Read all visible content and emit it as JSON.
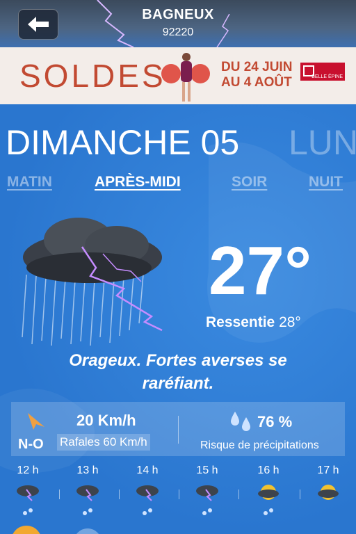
{
  "header": {
    "city": "BAGNEUX",
    "zip": "92220",
    "back_icon": "arrow-left-icon"
  },
  "ad": {
    "headline": "SOLDES",
    "dates_line1": "DU 24 JUIN",
    "dates_line2": "AU 4 AOÛT",
    "brand": "BELLE ÉPINE"
  },
  "days": {
    "current": "DIMANCHE 05",
    "next": "LUN"
  },
  "tabs": [
    {
      "label": "MATIN",
      "active": false
    },
    {
      "label": "APRÈS-MIDI",
      "active": true
    },
    {
      "label": "SOIR",
      "active": false
    },
    {
      "label": "NUIT",
      "active": false
    }
  ],
  "weather": {
    "temperature": "27°",
    "feels_label": "Ressentie",
    "feels_value": "28°",
    "description_line1": "Orageux. Fortes averses se",
    "description_line2": "raréfiant.",
    "main_icon": "thunderstorm-cloud-icon"
  },
  "details": {
    "wind_direction": "N-O",
    "wind_speed": "20 Km/h",
    "gusts": "Rafales 60 Km/h",
    "rain_probability": "76 %",
    "rain_label": "Risque de précipitations"
  },
  "hourly": [
    {
      "hour": "12 h",
      "icon": "thunderstorm-icon"
    },
    {
      "hour": "13 h",
      "icon": "thunderstorm-icon"
    },
    {
      "hour": "14 h",
      "icon": "thunderstorm-icon"
    },
    {
      "hour": "15 h",
      "icon": "thunderstorm-icon"
    },
    {
      "hour": "16 h",
      "icon": "sun-storm-icon"
    },
    {
      "hour": "17 h",
      "icon": "sun-storm-icon"
    }
  ],
  "colors": {
    "background": "#2f7fd6",
    "ad_red": "#c24a32",
    "wind_arrow": "#f0a040",
    "lightning": "#b66cff"
  }
}
